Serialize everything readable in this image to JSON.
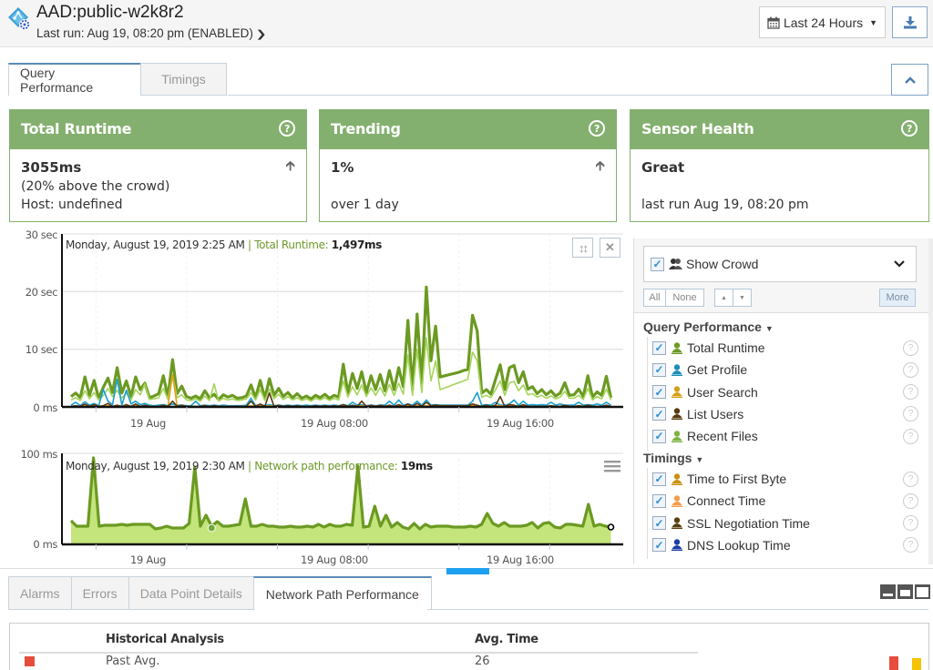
{
  "header": {
    "title": "AAD:public-w2k8r2",
    "subtitle": "Last run: Aug 19, 08:20 pm (ENABLED)",
    "range_label": "Last 24 Hours"
  },
  "top_tabs": [
    {
      "label": "Query Performance",
      "active": true
    },
    {
      "label": "Timings",
      "active": false
    }
  ],
  "cards": [
    {
      "title": "Total Runtime",
      "value": "3055ms",
      "line2": "(20% above the crowd)",
      "line3": "Host: undefined",
      "trend": "up"
    },
    {
      "title": "Trending",
      "value": "1%",
      "line2": "",
      "line3": "over 1 day",
      "trend": "up"
    },
    {
      "title": "Sensor Health",
      "value": "Great",
      "line2": "",
      "line3": "last run Aug 19, 08:20 pm",
      "trend": ""
    }
  ],
  "colors": {
    "card_green": "#84b06f",
    "runtime_green": "#6b9a22",
    "light_green": "#a5d45a",
    "area_fill": "#c3e57c",
    "accent_blue": "#1ea0f0",
    "past_avg_red": "#e74c3c",
    "yellow": "#f4c400"
  },
  "chart_data": [
    {
      "type": "line",
      "title": "Query Performance",
      "tooltip": {
        "date": "Monday, August 19, 2019 2:25 AM",
        "series": "Total Runtime:",
        "value": "1,497ms"
      },
      "y_ticks": [
        "30 sec",
        "20 sec",
        "10 sec",
        "0 ms"
      ],
      "ylim": [
        0,
        30
      ],
      "yunit": "sec",
      "x_ticks": [
        "19 Aug",
        "19 Aug 08:00",
        "19 Aug 16:00"
      ],
      "x_hours": [
        -5.5,
        19
      ],
      "series": [
        {
          "name": "Total Runtime",
          "color": "#6b9a22",
          "values": [
            1.8,
            2.4,
            1.6,
            5.2,
            2.0,
            4.6,
            1.5,
            3.4,
            5.0,
            2.5,
            6.8,
            2.4,
            4.5,
            1.8,
            5.2,
            3.0,
            4.1,
            1.6,
            1.9,
            2.3,
            5.4,
            1.7,
            8.2,
            2.3,
            3.6,
            1.8,
            1.5,
            1.9,
            1.4,
            2.8,
            1.6,
            2.2,
            1.3,
            2.1,
            1.7,
            2.0,
            1.5,
            1.6,
            1.9,
            3.8,
            1.6,
            4.6,
            1.5,
            4.9,
            2.0,
            3.2,
            1.8,
            2.5,
            1.6,
            2.3,
            1.5,
            1.9,
            1.4,
            2.0,
            1.6,
            2.2,
            1.5,
            2.0,
            1.7,
            7.4,
            2.4,
            5.8,
            3.2,
            6.1,
            2.5,
            5.4,
            3.0,
            5.6,
            2.8,
            6.3,
            3.0,
            6.8,
            3.5,
            15.0,
            3.0,
            16.1,
            4.0,
            20.8,
            8.0,
            14.0,
            5.2,
            5.4,
            5.6,
            5.8,
            6.0,
            6.3,
            6.5,
            15.9,
            13.2,
            2.4,
            3.0,
            2.2,
            4.8,
            7.3,
            3.0,
            6.8,
            7.2,
            4.2,
            6.1,
            3.1,
            3.5,
            2.3,
            3.0,
            2.1,
            2.8,
            1.9,
            2.4,
            4.2,
            2.0,
            2.1,
            3.1,
            1.8,
            5.4,
            1.7,
            2.6,
            2.0,
            5.3,
            1.6
          ]
        },
        {
          "name": "Recent Files",
          "color": "#a5d45a",
          "values": [
            1.2,
            1.6,
            1.1,
            2.8,
            1.4,
            2.5,
            1.2,
            2.0,
            3.2,
            1.8,
            2.9,
            1.5,
            2.4,
            1.2,
            3.0,
            2.1,
            4.0,
            1.3,
            1.4,
            1.6,
            3.2,
            1.3,
            5.5,
            1.6,
            2.1,
            1.2,
            1.1,
            1.4,
            1.0,
            1.9,
            1.1,
            4.0,
            1.0,
            1.5,
            1.2,
            1.4,
            1.1,
            1.2,
            1.4,
            2.5,
            1.2,
            3.0,
            1.1,
            3.1,
            1.4,
            2.2,
            1.3,
            1.8,
            1.2,
            1.6,
            1.1,
            1.4,
            1.0,
            1.5,
            1.2,
            1.6,
            1.1,
            1.5,
            1.2,
            4.5,
            1.7,
            3.5,
            2.1,
            3.8,
            1.8,
            3.3,
            2.0,
            3.4,
            1.9,
            3.9,
            2.0,
            4.1,
            2.2,
            9.0,
            2.0,
            10.0,
            2.5,
            12.0,
            4.5,
            8.0,
            3.0,
            3.3,
            3.6,
            3.9,
            4.2,
            4.5,
            4.8,
            9.5,
            8.0,
            1.7,
            2.0,
            1.6,
            3.0,
            4.5,
            2.0,
            4.2,
            4.4,
            2.8,
            3.8,
            2.1,
            2.3,
            1.7,
            2.0,
            1.5,
            1.9,
            1.4,
            1.7,
            2.7,
            1.5,
            1.5,
            2.0,
            1.3,
            3.2,
            1.2,
            1.8,
            1.4,
            3.1,
            1.2
          ]
        },
        {
          "name": "Get Profile",
          "color": "#1a9fd0",
          "values": [
            0.3,
            0.8,
            0.2,
            0.9,
            0.3,
            0.6,
            0.2,
            3.0,
            1.0,
            0.4,
            4.8,
            0.3,
            2.9,
            0.5,
            1.0,
            0.4,
            0.6,
            0.3,
            0.2,
            0.3,
            0.4,
            0.2,
            0.5,
            0.3,
            0.3,
            0.2,
            0.2,
            1.0,
            0.2,
            0.3,
            0.2,
            0.3,
            0.2,
            0.3,
            0.2,
            0.2,
            0.2,
            0.2,
            0.3,
            1.5,
            0.2,
            0.4,
            0.2,
            0.4,
            0.2,
            0.3,
            0.2,
            0.3,
            0.2,
            0.3,
            0.2,
            0.3,
            0.2,
            0.3,
            0.2,
            0.3,
            0.2,
            0.3,
            0.2,
            0.4,
            0.2,
            0.8,
            0.3,
            0.4,
            0.2,
            0.3,
            0.2,
            0.3,
            0.3,
            1.0,
            0.3,
            1.2,
            0.3,
            0.5,
            0.3,
            1.0,
            0.3,
            1.2,
            0.3,
            0.4,
            0.3,
            0.3,
            0.3,
            0.3,
            0.3,
            0.3,
            0.3,
            1.0,
            2.5,
            0.3,
            0.4,
            0.3,
            0.8,
            0.3,
            0.3,
            0.5,
            1.2,
            0.3,
            1.0,
            0.3,
            0.4,
            0.3,
            0.4,
            0.3,
            0.8,
            0.3,
            0.5,
            0.3,
            0.3,
            0.3,
            0.8,
            0.3,
            0.4,
            0.3,
            0.5,
            0.3,
            0.8,
            0.3
          ]
        },
        {
          "name": "User Search",
          "color": "#e0a11b",
          "values": [
            0.1,
            0.1,
            0.1,
            0.2,
            0.1,
            0.2,
            0.1,
            0.1,
            0.2,
            0.1,
            0.2,
            0.1,
            0.2,
            0.1,
            0.2,
            0.1,
            0.2,
            0.1,
            0.1,
            0.1,
            0.2,
            0.1,
            5.6,
            0.1,
            0.2,
            0.1,
            0.1,
            0.1,
            0.1,
            0.1,
            0.1,
            0.1,
            0.1,
            0.1,
            0.1,
            0.1,
            0.1,
            0.1,
            0.1,
            0.2,
            0.1,
            0.2,
            0.1,
            0.2,
            0.1,
            0.1,
            0.1,
            0.1,
            0.1,
            0.1,
            0.1,
            0.1,
            0.1,
            0.1,
            0.1,
            0.1,
            0.1,
            0.1,
            0.1,
            0.2,
            0.1,
            0.2,
            0.1,
            0.2,
            0.1,
            0.2,
            0.1,
            0.2,
            0.1,
            0.2,
            0.1,
            0.2,
            0.1,
            0.2,
            0.1,
            0.2,
            0.1,
            0.2,
            0.1,
            0.2,
            0.1,
            0.1,
            0.1,
            0.1,
            0.1,
            0.1,
            0.1,
            0.2,
            0.2,
            0.1,
            0.1,
            0.1,
            0.2,
            0.2,
            0.1,
            0.2,
            0.2,
            0.1,
            0.2,
            0.1,
            0.1,
            0.1,
            0.1,
            0.1,
            0.1,
            0.1,
            0.1,
            0.2,
            0.1,
            0.1,
            0.1,
            0.1,
            0.2,
            0.1,
            0.1,
            0.1,
            0.2,
            0.1
          ]
        },
        {
          "name": "List Users",
          "color": "#5b3a10",
          "values": [
            0.1,
            0.2,
            0.1,
            0.5,
            0.1,
            0.4,
            0.1,
            0.2,
            0.6,
            0.1,
            0.3,
            0.1,
            0.4,
            0.1,
            0.5,
            0.1,
            0.3,
            0.1,
            0.1,
            0.1,
            0.3,
            0.1,
            1.0,
            0.1,
            0.3,
            0.1,
            0.1,
            0.1,
            0.1,
            0.2,
            0.1,
            0.2,
            0.1,
            0.1,
            0.1,
            0.1,
            0.1,
            0.1,
            0.1,
            1.0,
            0.1,
            0.5,
            0.1,
            2.4,
            0.1,
            0.3,
            0.1,
            0.2,
            0.1,
            0.2,
            0.1,
            0.1,
            0.1,
            0.2,
            0.1,
            0.2,
            0.1,
            0.2,
            0.1,
            0.4,
            0.1,
            0.3,
            0.1,
            1.0,
            0.1,
            0.3,
            0.1,
            0.3,
            0.1,
            0.3,
            0.1,
            0.4,
            0.1,
            0.5,
            0.1,
            0.6,
            0.1,
            0.8,
            0.2,
            0.3,
            0.2,
            0.2,
            0.2,
            0.2,
            0.2,
            0.2,
            0.2,
            0.5,
            0.3,
            0.1,
            0.3,
            0.1,
            0.3,
            1.8,
            0.1,
            0.4,
            0.3,
            0.1,
            0.4,
            0.1,
            0.1,
            0.1,
            0.1,
            0.1,
            0.2,
            0.1,
            0.1,
            0.3,
            0.1,
            0.1,
            0.2,
            0.1,
            0.3,
            0.1,
            0.1,
            0.1,
            0.3,
            0.1
          ]
        }
      ]
    },
    {
      "type": "area",
      "title": "Network Path Performance",
      "tooltip": {
        "date": "Monday, August 19, 2019 2:30 AM",
        "series": "Network path performance:",
        "value": "19ms"
      },
      "y_ticks": [
        "100 ms",
        "0 ms"
      ],
      "ylim": [
        0,
        100
      ],
      "yunit": "ms",
      "x_ticks": [
        "19 Aug",
        "19 Aug 08:00",
        "19 Aug 16:00"
      ],
      "x_hours": [
        -5.5,
        19
      ],
      "series": [
        {
          "name": "Network path performance",
          "color": "#6b9a22",
          "fill": "#c3e57c",
          "values": [
            26,
            20,
            20,
            20,
            95,
            20,
            21,
            21,
            21,
            22,
            21,
            22,
            22,
            22,
            22,
            17,
            18,
            20,
            18,
            18,
            18,
            23,
            85,
            20,
            32,
            20,
            25,
            20,
            20,
            21,
            22,
            50,
            20,
            20,
            22,
            20,
            20,
            19,
            19,
            20,
            19,
            19,
            20,
            19,
            22,
            19,
            22,
            20,
            20,
            22,
            21,
            86,
            19,
            20,
            42,
            20,
            32,
            19,
            24,
            19,
            17,
            23,
            17,
            22,
            19,
            20,
            20,
            20,
            19,
            19,
            19,
            20,
            19,
            22,
            34,
            23,
            20,
            24,
            20,
            20,
            20,
            21,
            24,
            18,
            23,
            24,
            19,
            18,
            22,
            22,
            21,
            20,
            44,
            20,
            22,
            20,
            19
          ]
        }
      ]
    }
  ],
  "chart_controls": {
    "reset_zoom": "reset-zoom",
    "close": "close",
    "menu": "menu"
  },
  "side_panel": {
    "show_crowd": {
      "label": "Show Crowd",
      "checked": true
    },
    "buttons": {
      "all": "All",
      "none": "None",
      "more": "More"
    },
    "groups": [
      {
        "title": "Query Performance",
        "items": [
          {
            "label": "Total Runtime",
            "color": "#6b9a22",
            "checked": true
          },
          {
            "label": "Get Profile",
            "color": "#1a8fb8",
            "checked": true
          },
          {
            "label": "User Search",
            "color": "#d4a017",
            "checked": true
          },
          {
            "label": "List Users",
            "color": "#5b3a10",
            "checked": true
          },
          {
            "label": "Recent Files",
            "color": "#7cb342",
            "checked": true
          }
        ]
      },
      {
        "title": "Timings",
        "items": [
          {
            "label": "Time to First Byte",
            "color": "#c9920e",
            "checked": true
          },
          {
            "label": "Connect Time",
            "color": "#f39c4a",
            "checked": true
          },
          {
            "label": "SSL Negotiation Time",
            "color": "#5a4010",
            "checked": true
          },
          {
            "label": "DNS Lookup Time",
            "color": "#1b3fa8",
            "checked": true
          }
        ]
      }
    ]
  },
  "bottom_tabs": [
    {
      "label": "Alarms",
      "active": false
    },
    {
      "label": "Errors",
      "active": false
    },
    {
      "label": "Data Point Details",
      "active": false
    },
    {
      "label": "Network Path Performance",
      "active": true
    }
  ],
  "table": {
    "headers": [
      "Historical Analysis",
      "Avg. Time"
    ],
    "rows": [
      {
        "label": "Past Avg.",
        "value": "26",
        "color": "#e74c3c"
      }
    ]
  }
}
